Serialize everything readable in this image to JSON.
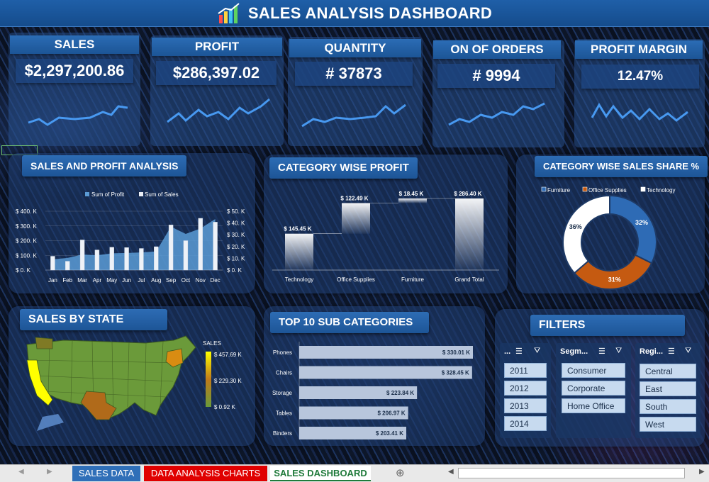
{
  "title": "SALES ANALYSIS DASHBOARD",
  "kpis": [
    {
      "label": "SALES",
      "value": "$2,297,200.86"
    },
    {
      "label": "PROFIT",
      "value": "$286,397.02"
    },
    {
      "label": "QUANTITY",
      "value": "# 37873"
    },
    {
      "label": "ON OF ORDERS",
      "value": "# 9994"
    },
    {
      "label": "PROFIT MARGIN",
      "value": "12.47%"
    }
  ],
  "panels": {
    "sales_profit": "SALES AND PROFIT ANALYSIS",
    "category_profit": "CATEGORY WISE PROFIT",
    "category_share": "CATEGORY WISE SALES SHARE %",
    "sales_by_state": "SALES BY STATE",
    "top_sub": "TOP 10 SUB CATEGORIES",
    "filters": "FILTERS"
  },
  "chart_data": [
    {
      "type": "bar",
      "title": "SALES AND PROFIT ANALYSIS",
      "categories": [
        "Jan",
        "Feb",
        "Mar",
        "Apr",
        "May",
        "Jun",
        "Jul",
        "Aug",
        "Sep",
        "Oct",
        "Nov",
        "Dec"
      ],
      "series": [
        {
          "name": "Sum of Profit",
          "type": "area",
          "axis": "right",
          "values": [
            9.1,
            10.3,
            13.2,
            12.6,
            14.2,
            14.5,
            15.0,
            15.8,
            36.9,
            30.7,
            35.3,
            43.4
          ]
        },
        {
          "name": "Sum of Sales",
          "type": "bar",
          "axis": "left",
          "values": [
            94,
            60,
            205,
            137,
            155,
            153,
            147,
            159,
            307,
            200,
            352,
            326
          ]
        }
      ],
      "left_ticks": [
        "$ 0. K",
        "$ 100. K",
        "$ 200. K",
        "$ 300. K",
        "$ 400. K"
      ],
      "right_ticks": [
        "$ 0. K",
        "$ 10. K",
        "$ 20. K",
        "$ 30. K",
        "$ 40. K",
        "$ 50. K"
      ],
      "ylim_left": [
        0,
        400
      ],
      "ylim_right": [
        0,
        50
      ],
      "legend": "top"
    },
    {
      "type": "bar",
      "subtype": "waterfall",
      "title": "CATEGORY WISE PROFIT",
      "categories": [
        "Technology",
        "Office Supplies",
        "Furniture",
        "Grand Total"
      ],
      "values": [
        145.45,
        122.49,
        18.45,
        286.4
      ],
      "labels": [
        "$ 145.45 K",
        "$ 122.49 K",
        "$ 18.45 K",
        "$ 286.40 K"
      ]
    },
    {
      "type": "pie",
      "subtype": "donut",
      "title": "CATEGORY WISE SALES SHARE %",
      "categories": [
        "Furniture",
        "Office Supplies",
        "Technology"
      ],
      "values": [
        32,
        31,
        36
      ],
      "labels": [
        "32%",
        "31%",
        "36%"
      ],
      "colors": [
        "#2e6bb5",
        "#c55a11",
        "#ffffff"
      ],
      "legend": "top"
    },
    {
      "type": "bar",
      "orientation": "horizontal",
      "title": "TOP 10 SUB CATEGORIES",
      "categories": [
        "Phones",
        "Chairs",
        "Storage",
        "Tables",
        "Binders"
      ],
      "values": [
        330.01,
        328.45,
        223.84,
        206.97,
        203.41
      ],
      "labels": [
        "$ 330.01 K",
        "$ 328.45 K",
        "$ 223.84 K",
        "$ 206.97 K",
        "$ 203.41 K"
      ]
    },
    {
      "type": "heatmap",
      "subtype": "map",
      "title": "SALES BY STATE",
      "legend_title": "SALES",
      "legend_ticks": [
        "$ 457.69 K",
        "$ 229.30 K",
        "$ 0.92 K"
      ],
      "colors": [
        "#ffff00",
        "#c07a1a",
        "#6b9a3a"
      ]
    }
  ],
  "filters": {
    "columns": [
      {
        "header": "...",
        "items": [
          "2011",
          "2012",
          "2013",
          "2014"
        ]
      },
      {
        "header": "Segm...",
        "items": [
          "Consumer",
          "Corporate",
          "Home Office"
        ]
      },
      {
        "header": "Regi...",
        "items": [
          "Central",
          "East",
          "South",
          "West"
        ]
      }
    ]
  },
  "sheet_tabs": [
    "SALES DATA",
    "DATA ANALYSIS CHARTS",
    "SALES DASHBOARD"
  ],
  "colors": {
    "accent": "#1f5fa8",
    "sales_bar": "#eaeef5",
    "profit_area": "#5b9bd5",
    "spark": "#4da3ff"
  }
}
